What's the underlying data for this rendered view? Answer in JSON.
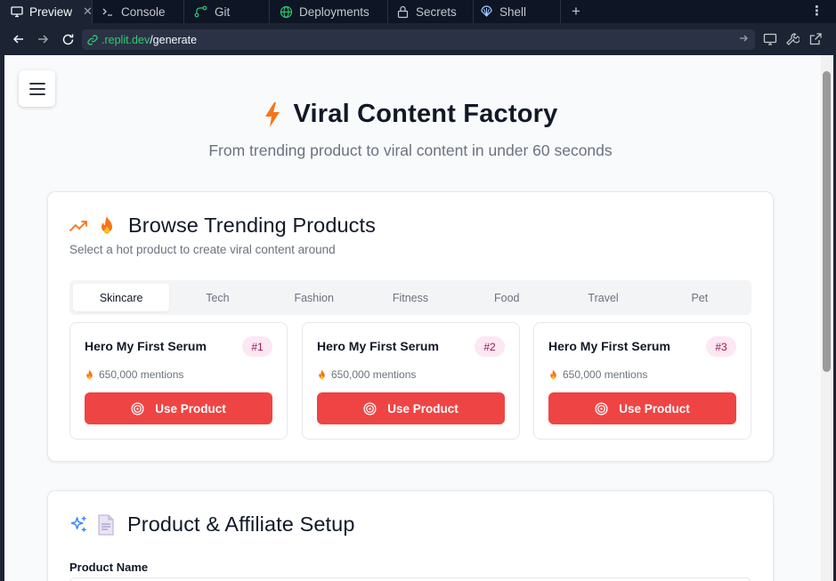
{
  "ide": {
    "tabs": [
      {
        "label": "Preview",
        "icon": "monitor-icon",
        "active": true
      },
      {
        "label": "Console",
        "icon": "terminal-icon"
      },
      {
        "label": "Git",
        "icon": "git-branch-icon"
      },
      {
        "label": "Deployments",
        "icon": "globe-icon"
      },
      {
        "label": "Secrets",
        "icon": "lock-icon"
      },
      {
        "label": "Shell",
        "icon": "shell-icon"
      }
    ],
    "url_domain": ".replit.dev",
    "url_path": "/generate"
  },
  "hero": {
    "title": "Viral Content Factory",
    "subtitle": "From trending product to viral content in under 60 seconds"
  },
  "trending": {
    "title": "Browse Trending Products",
    "description": "Select a hot product to create viral content around",
    "categories": [
      "Skincare",
      "Tech",
      "Fashion",
      "Fitness",
      "Food",
      "Travel",
      "Pet"
    ],
    "active_category": "Skincare",
    "products": [
      {
        "name": "Hero My First Serum",
        "rank": "#1",
        "mentions": "650,000 mentions",
        "button": "Use Product"
      },
      {
        "name": "Hero My First Serum",
        "rank": "#2",
        "mentions": "650,000 mentions",
        "button": "Use Product"
      },
      {
        "name": "Hero My First Serum",
        "rank": "#3",
        "mentions": "650,000 mentions",
        "button": "Use Product"
      }
    ]
  },
  "setup": {
    "title": "Product & Affiliate Setup",
    "product_name_label": "Product Name"
  },
  "colors": {
    "accent_red": "#ef4444",
    "trend_orange": "#f97316",
    "sparkle_blue": "#3b82f6",
    "rank_badge_bg": "#fce7f3",
    "rank_badge_text": "#9d174d"
  }
}
